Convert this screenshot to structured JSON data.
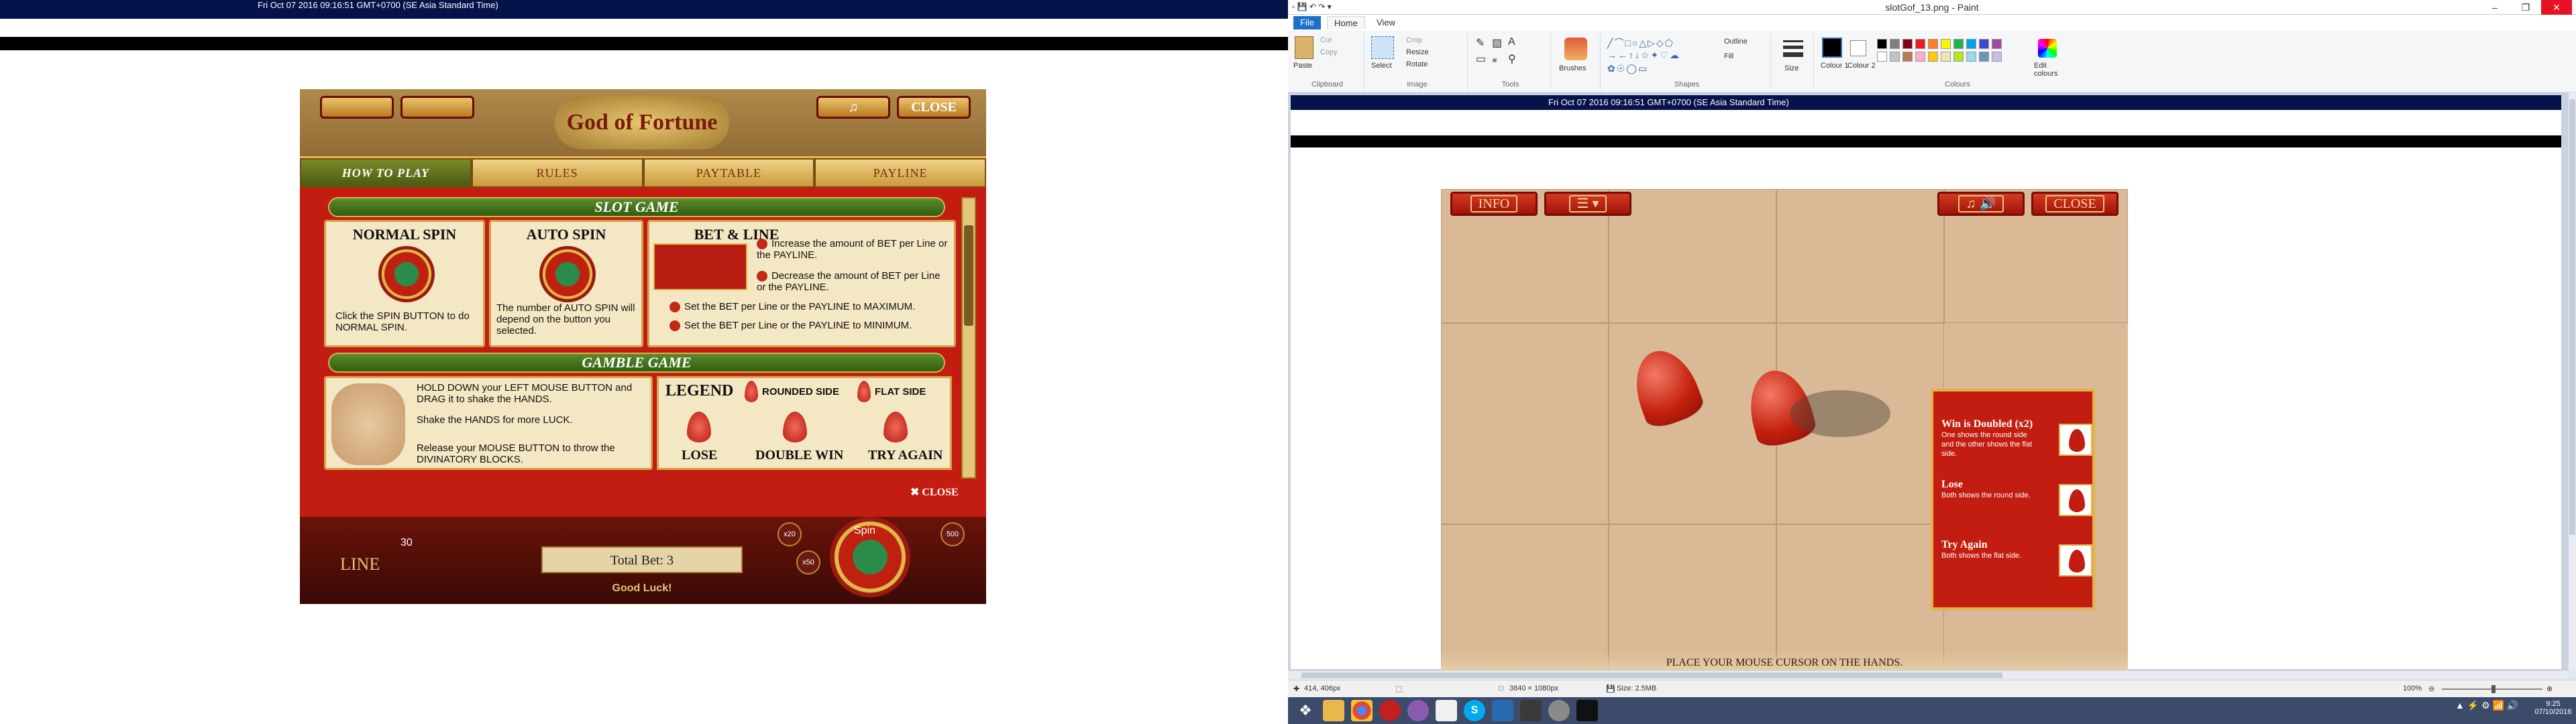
{
  "left_screen": {
    "timestamp": "Fri Oct 07 2016 09:16:51 GMT+0700 (SE Asia Standard Time)",
    "game": {
      "top_buttons": [
        "",
        "",
        "",
        "CLOSE"
      ],
      "logo_text": "God of Fortune",
      "tabs": [
        "HOW TO PLAY",
        "RULES",
        "PAYTABLE",
        "PAYLINE"
      ],
      "active_tab": "HOW TO PLAY",
      "slot_game_heading": "SLOT GAME",
      "normal_spin": {
        "title": "NORMAL SPIN",
        "desc": "Click the SPIN BUTTON to do NORMAL SPIN."
      },
      "auto_spin": {
        "title": "AUTO SPIN",
        "desc": "The number of AUTO SPIN will depend on the button you selected."
      },
      "bet_line": {
        "title": "BET & LINE",
        "items": [
          "Increase the amount of BET per Line or the PAYLINE.",
          "Decrease the amount of BET per Line or the PAYLINE.",
          "Set the BET per Line or the PAYLINE to MAXIMUM.",
          "Set the BET per Line or the PAYLINE to MINIMUM."
        ]
      },
      "gamble_game_heading": "GAMBLE GAME",
      "gamble_instructions": [
        "HOLD DOWN your LEFT MOUSE BUTTON and DRAG it to shake the HANDS.",
        "Shake the HANDS for more LUCK.",
        "Release your MOUSE BUTTON to throw the DIVINATORY BLOCKS."
      ],
      "legend": {
        "title": "LEGEND",
        "rounded_side": "ROUNDED SIDE",
        "flat_side": "FLAT SIDE",
        "lose": "LOSE",
        "double_win": "DOUBLE WIN",
        "try_again": "TRY AGAIN"
      },
      "close_link": "CLOSE",
      "bottom": {
        "line_label": "LINE",
        "line_value": "30",
        "total_bet": "Total Bet: 3",
        "good_luck": "Good Luck!",
        "spin": "Spin",
        "x20": "x20",
        "x50": "x50",
        "x500": "500"
      }
    }
  },
  "paint": {
    "window_title": "slotGof_13.png - Paint",
    "menu_tabs": [
      "File",
      "Home",
      "View"
    ],
    "ribbon": {
      "clipboard": {
        "label": "Clipboard",
        "paste": "Paste",
        "cut": "Cut",
        "copy": "Copy"
      },
      "image": {
        "label": "Image",
        "select": "Select",
        "crop": "Crop",
        "resize": "Resize",
        "rotate": "Rotate"
      },
      "tools": {
        "label": "Tools"
      },
      "brushes": "Brushes",
      "shapes": {
        "label": "Shapes",
        "outline": "Outline",
        "fill": "Fill"
      },
      "size": "Size",
      "colours": {
        "label": "Colours",
        "colour1": "Colour 1",
        "colour2": "Colour 2",
        "edit": "Edit colours"
      },
      "palette": [
        "#000000",
        "#7f7f7f",
        "#880015",
        "#ed1c24",
        "#ff7f27",
        "#fff200",
        "#22b14c",
        "#00a2e8",
        "#3f48cc",
        "#a349a4",
        "#ffffff",
        "#c3c3c3",
        "#b97a57",
        "#ffaec9",
        "#ffc90e",
        "#efe4b0",
        "#b5e61d",
        "#99d9ea",
        "#7092be",
        "#c8bfe7"
      ]
    },
    "canvas": {
      "timestamp": "Fri Oct 07 2016 09:16:51 GMT+0700 (SE Asia Standard Time)",
      "buttons": [
        "INFO",
        "",
        "",
        "CLOSE"
      ],
      "paytable": [
        {
          "title": "Win is Doubled (x2)",
          "desc": "One shows the round side and the other shows the flat side."
        },
        {
          "title": "Lose",
          "desc": "Both shows the round side."
        },
        {
          "title": "Try Again",
          "desc": "Both shows the flat side."
        }
      ],
      "hint": "PLACE YOUR MOUSE CURSOR ON THE HANDS."
    },
    "status": {
      "cursor": "414, 406px",
      "dimensions": "3840 × 1080px",
      "size": "Size: 2.5MB",
      "zoom": "100%"
    }
  },
  "taskbar": {
    "time": "9:25",
    "date": "07/10/2016"
  }
}
